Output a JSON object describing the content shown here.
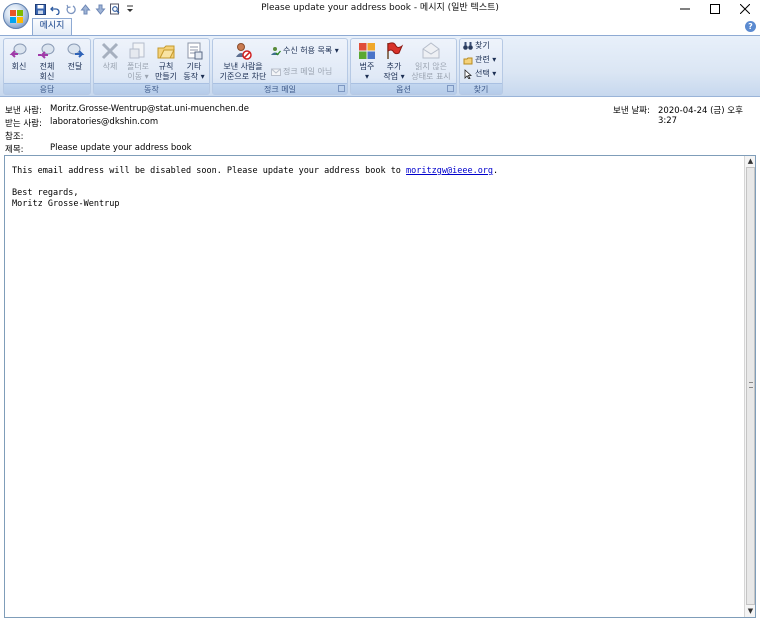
{
  "window": {
    "title": "Please update your address book - 메시지 (일반 텍스트)"
  },
  "tabs": [
    {
      "label": "메시지"
    }
  ],
  "ribbon": {
    "groups": {
      "respond": {
        "label": "응답",
        "reply": "회신",
        "reply_all_1": "전체",
        "reply_all_2": "회신",
        "forward": "전달"
      },
      "actions": {
        "label": "동작",
        "delete": "삭제",
        "move_1": "폴더로",
        "move_2": "이동 ▾",
        "rule_1": "규칙",
        "rule_2": "만들기",
        "other_1": "기타",
        "other_2": "동작 ▾"
      },
      "junk": {
        "label": "정크 메일",
        "block_1": "보낸 사람을",
        "block_2": "기준으로 차단",
        "safe_list": "수신 허용 목록 ▾",
        "not_junk": "정크 메일 아님"
      },
      "options": {
        "label": "옵션",
        "categorize": "범주",
        "categorize_2": "▾",
        "followup_1": "추가",
        "followup_2": "작업 ▾",
        "mark_unread_1": "읽지 않은",
        "mark_unread_2": "상태로 표시"
      },
      "find": {
        "label": "찾기",
        "find": "찾기",
        "related": "관련 ▾",
        "select": "선택 ▾"
      }
    }
  },
  "headers": {
    "from_label": "보낸 사람:",
    "from_value": "Moritz.Grosse-Wentrup@stat.uni-muenchen.de",
    "to_label": "받는 사람:",
    "to_value": "laboratories@dkshin.com",
    "cc_label": "참조:",
    "cc_value": "",
    "subject_label": "제목:",
    "subject_value": "Please update your address book",
    "sent_label": "보낸 날짜:",
    "sent_value": "2020-04-24 (금) 오후 3:27"
  },
  "message": {
    "line1_pre": "This email address will be disabled soon. Please update your address book to ",
    "link": "moritzgw@ieee.org",
    "line1_post": ".",
    "line3": "Best regards,",
    "line4": "Moritz Grosse-Wentrup"
  }
}
